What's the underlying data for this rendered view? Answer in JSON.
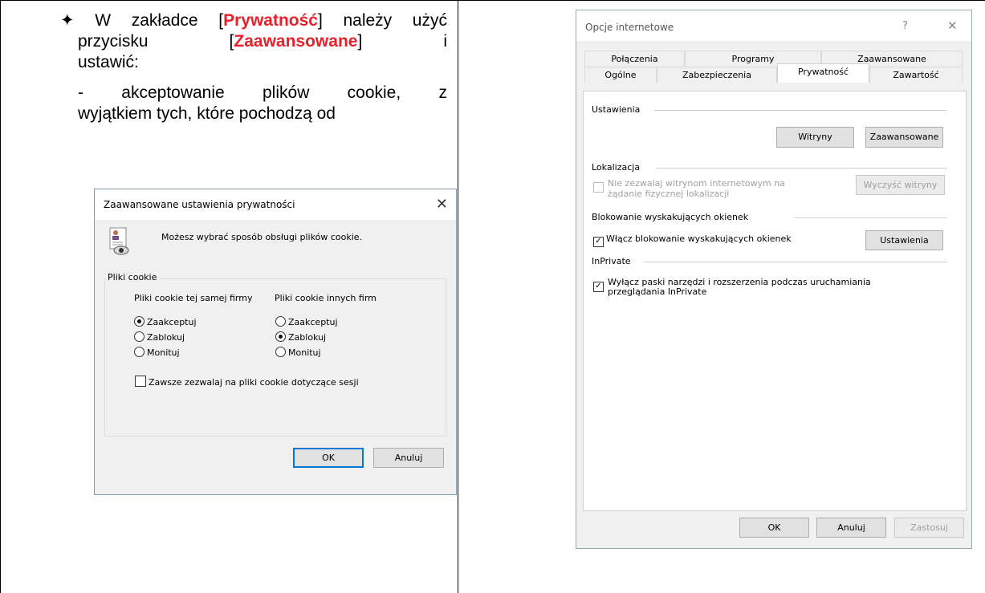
{
  "instruction": {
    "bullet": "✦",
    "line1_a": "W zakładce [",
    "line1_red": "Prywatność",
    "line1_b": "] należy użyć",
    "line2_a": "przycisku",
    "line2_bracket_open": "[",
    "line2_red": "Zaawansowane",
    "line2_bracket_close": "]",
    "line2_end": "i",
    "line3": "ustawić:",
    "line4": "- akceptowanie plików cookie, z",
    "line5": "wyjątkiem tych, które pochodzą od"
  },
  "advanced_dialog": {
    "title": "Zaawansowane ustawienia prywatności",
    "close": "✕",
    "description": "Możesz wybrać sposób obsługi plików cookie.",
    "group_label": "Pliki cookie",
    "first_party": {
      "header": "Pliki cookie tej samej firmy",
      "options": [
        "Zaakceptuj",
        "Zablokuj",
        "Monituj"
      ],
      "selected": "Zaakceptuj"
    },
    "third_party": {
      "header": "Pliki cookie innych firm",
      "options": [
        "Zaakceptuj",
        "Zablokuj",
        "Monituj"
      ],
      "selected": "Zablokuj"
    },
    "session_checkbox": "Zawsze zezwalaj na pliki cookie dotyczące sesji",
    "ok": "OK",
    "cancel": "Anuluj"
  },
  "internet_options": {
    "title": "Opcje internetowe",
    "help": "?",
    "close": "✕",
    "tabs_row1": [
      "Połączenia",
      "Programy",
      "Zaawansowane"
    ],
    "tabs_row2": [
      "Ogólne",
      "Zabezpieczenia",
      "Prywatność",
      "Zawartość"
    ],
    "active_tab": "Prywatność",
    "settings_header": "Ustawienia",
    "sites_button": "Witryny",
    "advanced_button": "Zaawansowane",
    "location_header": "Lokalizacja",
    "location_checkbox_line1": "Nie zezwalaj witrynom internetowym na",
    "location_checkbox_line2": "żądanie fizycznej lokalizacji",
    "clear_sites_button": "Wyczyść witryny",
    "popup_header": "Blokowanie wyskakujących okienek",
    "popup_checkbox": "Włącz blokowanie wyskakujących okienek",
    "popup_settings_button": "Ustawienia",
    "inprivate_header": "InPrivate",
    "inprivate_checkbox_line1": "Wyłącz paski narzędzi i rozszerzenia podczas uruchamiania",
    "inprivate_checkbox_line2": "przeglądania InPrivate",
    "ok": "OK",
    "cancel": "Anuluj",
    "apply": "Zastosuj"
  }
}
